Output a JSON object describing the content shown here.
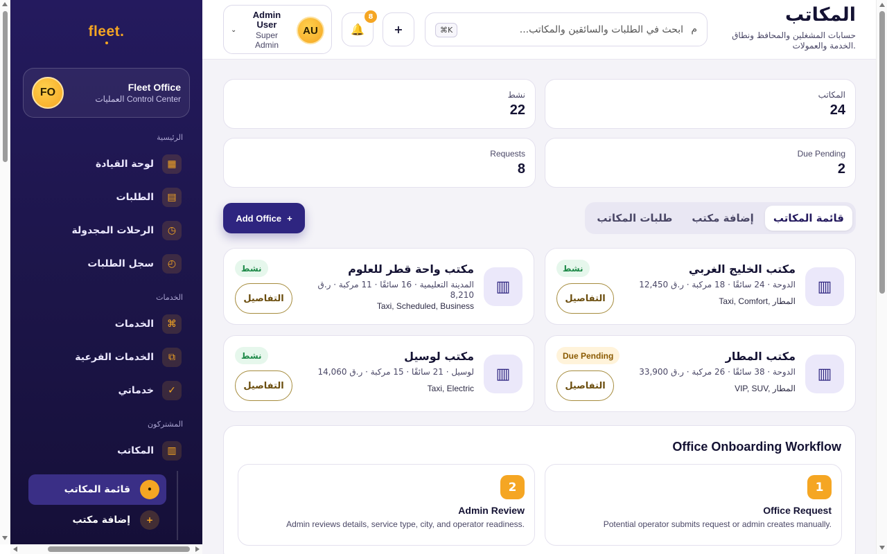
{
  "sidebar": {
    "logo": "fleet.",
    "brand": {
      "initials": "FO",
      "name": "Fleet Office",
      "subtitle": "العمليات Control Center"
    },
    "sections": [
      {
        "label": "الرئيسية",
        "items": [
          {
            "label": "لوحة القيادة",
            "icon": "dashboard-icon"
          },
          {
            "label": "الطلبات",
            "icon": "requests-icon"
          },
          {
            "label": "الرحلات المجدولة",
            "icon": "clock-icon"
          },
          {
            "label": "سجل الطلبات",
            "icon": "history-icon"
          }
        ]
      },
      {
        "label": "الخدمات",
        "items": [
          {
            "label": "الخدمات",
            "icon": "command-icon"
          },
          {
            "label": "الخدمات الفرعية",
            "icon": "layers-icon"
          },
          {
            "label": "خدماتي",
            "icon": "check-icon"
          }
        ]
      },
      {
        "label": "المشتركون",
        "items": [
          {
            "label": "المكاتب",
            "icon": "building-icon"
          }
        ]
      }
    ],
    "sub_items": [
      {
        "label": "قائمة المكاتب",
        "icon": "•",
        "active": true
      },
      {
        "label": "إضافة مكتب",
        "icon": "+",
        "active": false
      }
    ]
  },
  "header": {
    "title": "المكاتب",
    "description": "حسابات المشغلين والمحافظ ونطاق الخدمة والعمولات.",
    "search_placeholder": "ابحث في الطلبات والسائقين والمكاتب...",
    "search_icon": "م",
    "shortcut": "⌘K",
    "plus_label": "+",
    "notifications_count": "8",
    "user": {
      "initials": "AU",
      "name": "Admin User",
      "role": "Super Admin",
      "chevron": "⌄"
    }
  },
  "stats": [
    {
      "label": "المكاتب",
      "value": "24"
    },
    {
      "label": "نشط",
      "value": "22"
    },
    {
      "label": "Due Pending",
      "value": "2"
    },
    {
      "label": "Requests",
      "value": "8"
    }
  ],
  "tabs": [
    {
      "label": "قائمة المكاتب",
      "active": true
    },
    {
      "label": "إضافة مكتب",
      "active": false
    },
    {
      "label": "طلبات المكاتب",
      "active": false
    }
  ],
  "add_office_label": "Add Office",
  "add_office_icon": "+",
  "details_label": "التفاصيل",
  "offices": [
    {
      "name": "مكتب الخليج الغربي",
      "meta": "الدوحة · 24 سائقًا · 18 مركبة · ر.ق 12,450",
      "tags": "Taxi, Comfort, المطار",
      "status": "نشط",
      "status_type": "ok"
    },
    {
      "name": "مكتب واحة قطر للعلوم",
      "meta": "المدينة التعليمية · 16 سائقًا · 11 مركبة · ر.ق 8,210",
      "tags": "Taxi, Scheduled, Business",
      "status": "نشط",
      "status_type": "ok"
    },
    {
      "name": "مكتب المطار",
      "meta": "الدوحة · 38 سائقًا · 26 مركبة · ر.ق 33,900",
      "tags": "VIP, SUV, المطار",
      "status": "Due Pending",
      "status_type": "due"
    },
    {
      "name": "مكتب لوسيل",
      "meta": "لوسيل · 21 سائقًا · 15 مركبة · ر.ق 14,060",
      "tags": "Taxi, Electric",
      "status": "نشط",
      "status_type": "ok"
    }
  ],
  "workflow": {
    "title": "Office Onboarding Workflow",
    "steps": [
      {
        "num": "1",
        "title": "Office Request",
        "desc": "Potential operator submits request or admin creates manually."
      },
      {
        "num": "2",
        "title": "Admin Review",
        "desc": "Admin reviews details, service type, city, and operator readiness."
      }
    ]
  },
  "colors": {
    "sidebar_bg": "#1c1548",
    "accent": "#f5a623",
    "primary": "#2e2580",
    "success": "#1f8a49"
  }
}
